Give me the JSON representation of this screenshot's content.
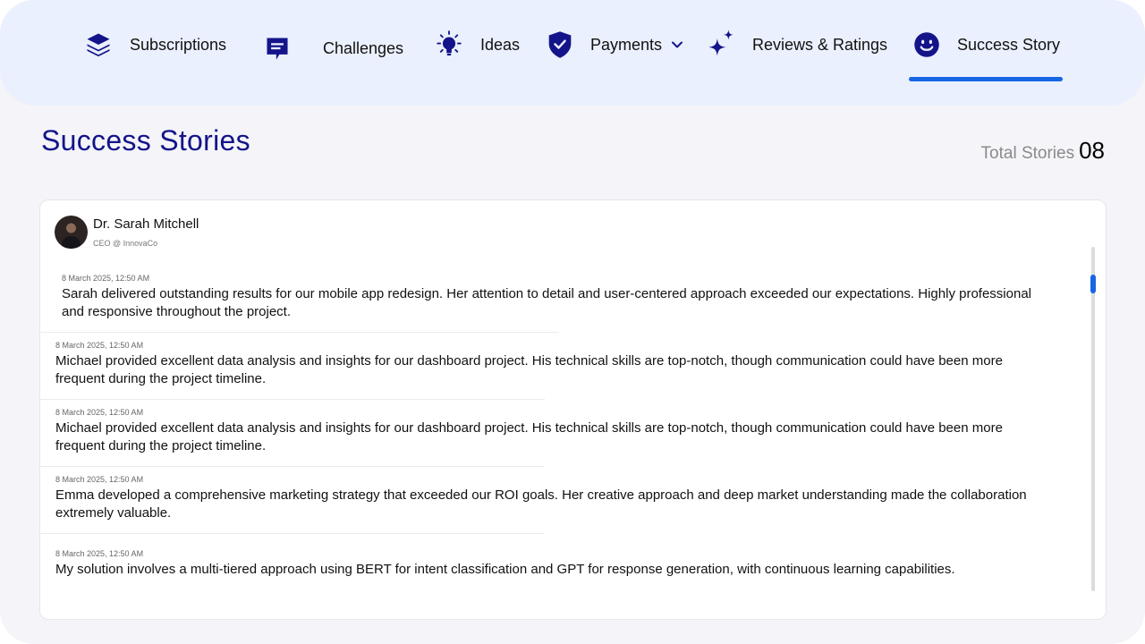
{
  "nav": {
    "items": [
      {
        "label": "Subscriptions",
        "icon": "layers-icon"
      },
      {
        "label": "Challenges",
        "icon": "chat-icon"
      },
      {
        "label": "Ideas",
        "icon": "lightbulb-icon"
      },
      {
        "label": "Payments",
        "icon": "shield-check-icon"
      },
      {
        "label": "Reviews & Ratings",
        "icon": "sparkles-icon"
      },
      {
        "label": "Success Story",
        "icon": "smiley-icon"
      }
    ],
    "active": "Success Story",
    "accent_color": "#1766e4",
    "icon_color": "#14148a"
  },
  "page": {
    "title": "Success Stories",
    "total_label": "Total Stories",
    "total_count": "08"
  },
  "author": {
    "name": "Dr. Sarah Mitchell",
    "role": "CEO @ InnovaCo"
  },
  "stories": [
    {
      "date": "8 March 2025, 12:50 AM",
      "text": "Sarah delivered outstanding results for our mobile app redesign. Her attention to detail and user-centered approach exceeded our expectations. Highly professional and responsive throughout the project."
    },
    {
      "date": "8 March 2025, 12:50 AM",
      "text": "Michael provided excellent data analysis and insights for our dashboard project. His technical skills are top-notch, though communication could have been more frequent during the project timeline."
    },
    {
      "date": "8 March 2025, 12:50 AM",
      "text": "Michael provided excellent data analysis and insights for our dashboard project. His technical skills are top-notch, though communication could have been more frequent during the project timeline."
    },
    {
      "date": "8 March 2025, 12:50 AM",
      "text": "Emma developed a comprehensive marketing strategy that exceeded our ROI goals. Her creative approach and deep market understanding made the collaboration extremely valuable."
    },
    {
      "date": "8 March 2025, 12:50 AM",
      "text": "My solution involves a multi-tiered approach using BERT for intent classification and GPT for response generation, with continuous learning capabilities."
    }
  ]
}
